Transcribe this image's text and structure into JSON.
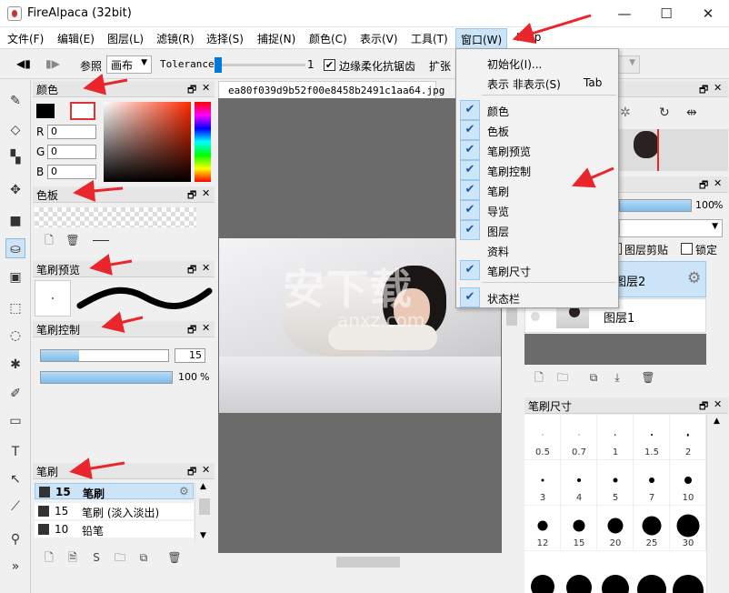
{
  "window": {
    "title": "FireAlpaca (32bit)",
    "minimize": "—",
    "maximize": "☐",
    "close": "✕"
  },
  "menubar": [
    "文件(F)",
    "编辑(E)",
    "图层(L)",
    "滤镜(R)",
    "选择(S)",
    "捕捉(N)",
    "颜色(C)",
    "表示(V)",
    "工具(T)",
    "窗口(W)",
    "Help"
  ],
  "toolbar": {
    "reference_label": "参照",
    "reference_value": "画布",
    "tolerance_label": "Tolerance",
    "tolerance_value": "1",
    "antialias_label": "边缘柔化抗锯齿",
    "expand_label": "扩张"
  },
  "panels": {
    "color": {
      "title": "颜色",
      "r_label": "R",
      "g_label": "G",
      "b_label": "B",
      "r": "0",
      "g": "0",
      "b": "0"
    },
    "palette": {
      "title": "色板"
    },
    "brush_preview": {
      "title": "笔刷预览"
    },
    "brush_control": {
      "title": "笔刷控制",
      "size": "15",
      "opacity": "100",
      "opacity_unit": "%",
      "size_fraction": 0.3,
      "opacity_fraction": 1.0
    },
    "brush": {
      "title": "笔刷",
      "items": [
        {
          "size": "15",
          "name": "笔刷"
        },
        {
          "size": "15",
          "name": "笔刷 (淡入淡出)"
        },
        {
          "size": "10",
          "name": "铅笔"
        }
      ]
    },
    "layer": {
      "opacity": "100",
      "opacity_unit": "%",
      "clip_label": "图层剪贴",
      "lock_label": "锁定",
      "layers": [
        "图层2",
        "图层1"
      ]
    },
    "brush_size": {
      "title": "笔刷尺寸",
      "sizes": [
        "0.5",
        "0.7",
        "1",
        "1.5",
        "2",
        "3",
        "4",
        "5",
        "7",
        "10",
        "12",
        "15",
        "20",
        "25",
        "30"
      ]
    }
  },
  "canvas": {
    "tab": "ea80f039d9b52f00e8458b2491c1aa64.jpg"
  },
  "window_menu": {
    "items": [
      {
        "label": "初始化(I)...",
        "checked": false
      },
      {
        "label": "表示 非表示(S)",
        "key": "Tab",
        "checked": false
      },
      {
        "label": "颜色",
        "checked": true
      },
      {
        "label": "色板",
        "checked": true
      },
      {
        "label": "笔刷预览",
        "checked": true
      },
      {
        "label": "笔刷控制",
        "checked": true
      },
      {
        "label": "笔刷",
        "checked": true
      },
      {
        "label": "导览",
        "checked": true
      },
      {
        "label": "图层",
        "checked": true
      },
      {
        "label": "资料",
        "checked": false
      },
      {
        "label": "笔刷尺寸",
        "checked": true
      },
      {
        "label": "状态栏",
        "checked": true
      }
    ],
    "check_glyph": "✔"
  },
  "watermark": {
    "text": "安下载",
    "sub": "anxz.com"
  },
  "colors": {
    "accent": "#cce4f7",
    "arrow": "#e8262b",
    "canvas_bg": "#6b6b6b"
  }
}
